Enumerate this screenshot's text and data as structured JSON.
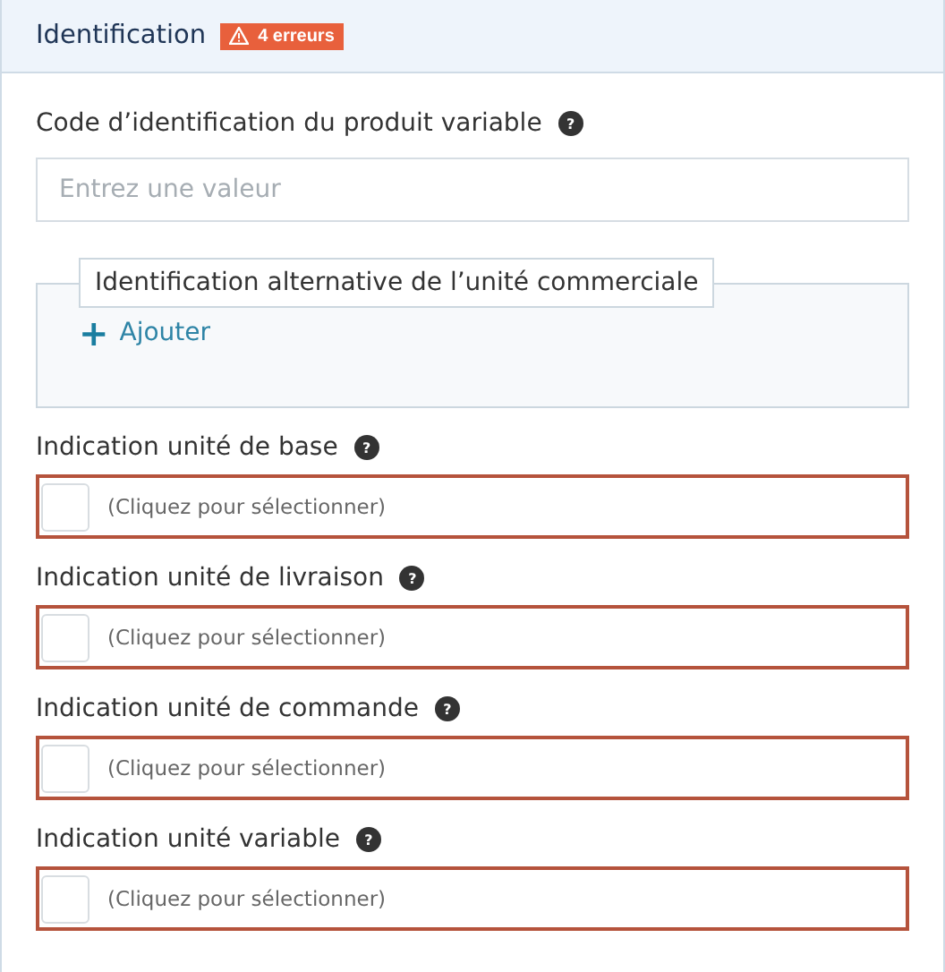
{
  "section": {
    "title": "Identification",
    "error_badge": "4 erreurs"
  },
  "code_field": {
    "label": "Code d’identification du produit variable",
    "help": "?",
    "placeholder": "Entrez une valeur"
  },
  "alt_group": {
    "legend": "Identification alternative de l’unité commerciale",
    "add_icon": "+",
    "add_label": "Ajouter"
  },
  "selects": [
    {
      "label": "Indication unité de base",
      "help": "?",
      "placeholder": "(Cliquez pour sélectionner)",
      "error": true
    },
    {
      "label": "Indication unité de livraison",
      "help": "?",
      "placeholder": "(Cliquez pour sélectionner)",
      "error": true
    },
    {
      "label": "Indication unité de commande",
      "help": "?",
      "placeholder": "(Cliquez pour sélectionner)",
      "error": true
    },
    {
      "label": "Indication unité variable",
      "help": "?",
      "placeholder": "(Cliquez pour sélectionner)",
      "error": true
    }
  ]
}
